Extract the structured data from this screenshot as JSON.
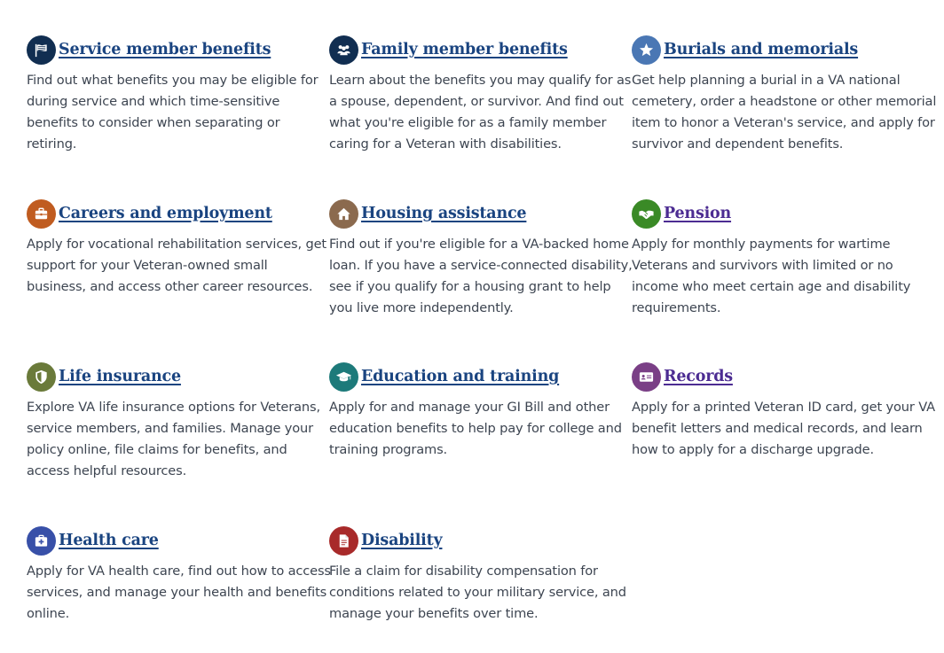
{
  "benefits": [
    {
      "title": "Service member benefits",
      "icon": "flag-icon",
      "color": "#112e51",
      "lines": [
        "Find out what benefits you may be eligible for",
        "during service and which time-sensitive",
        "benefits to consider when separating or",
        "retiring."
      ]
    },
    {
      "title": "Family member benefits",
      "icon": "family-icon",
      "color": "#112e51",
      "lines": [
        "Learn about the benefits you may qualify for as",
        "a spouse, dependent, or survivor. And find out",
        "what you're eligible for as a family member",
        "caring for a Veteran with disabilities."
      ]
    },
    {
      "title": "Burials and memorials",
      "icon": "star-icon",
      "color": "#4a77b4",
      "lines": [
        "Get help planning a burial in a VA national",
        "cemetery, order a headstone or other memorial",
        "item to honor a Veteran's service, and apply for",
        "survivor and dependent benefits."
      ]
    },
    {
      "title": "Careers and employment",
      "icon": "briefcase-icon",
      "color": "#c05c20",
      "lines": [
        "Apply for vocational rehabilitation services, get",
        "support for your Veteran-owned small",
        "business, and access other career resources."
      ]
    },
    {
      "title": "Housing assistance",
      "icon": "home-icon",
      "color": "#8b6a4e",
      "lines": [
        "Find out if you're eligible for a VA-backed home",
        "loan. If you have a service-connected disability,",
        "see if you qualify for a housing grant to help",
        "you live more independently."
      ]
    },
    {
      "title": "Pension",
      "icon": "handshake-icon",
      "color": "#3a8a26",
      "lines": [
        "Apply for monthly payments for wartime",
        "Veterans and survivors with limited or no",
        "income who meet certain age and disability",
        "requirements."
      ]
    },
    {
      "title": "Life insurance",
      "icon": "shield-icon",
      "color": "#6a7a3a",
      "lines": [
        "Explore VA life insurance options for Veterans,",
        "service members, and families. Manage your",
        "policy online, file claims for benefits, and",
        "access helpful resources."
      ]
    },
    {
      "title": "Education and training",
      "icon": "graduation-cap-icon",
      "color": "#1d7a7a",
      "lines": [
        "Apply for and manage your GI Bill and other",
        "education benefits to help pay for college and",
        "training programs."
      ]
    },
    {
      "title": "Records",
      "icon": "id-card-icon",
      "color": "#7a3f86",
      "lines": [
        "Apply for a printed Veteran ID card, get your VA",
        "benefit letters and medical records, and learn",
        "how to apply for a discharge upgrade."
      ]
    },
    {
      "title": "Health care",
      "icon": "medical-kit-icon",
      "color": "#3850a8",
      "lines": [
        "Apply for VA health care, find out how to access",
        "services, and manage your health and benefits",
        "online."
      ]
    },
    {
      "title": "Disability",
      "icon": "document-icon",
      "color": "#a82a2a",
      "lines": [
        "File a claim for disability compensation for",
        "conditions related to your military service, and",
        "manage your benefits over time."
      ]
    }
  ]
}
